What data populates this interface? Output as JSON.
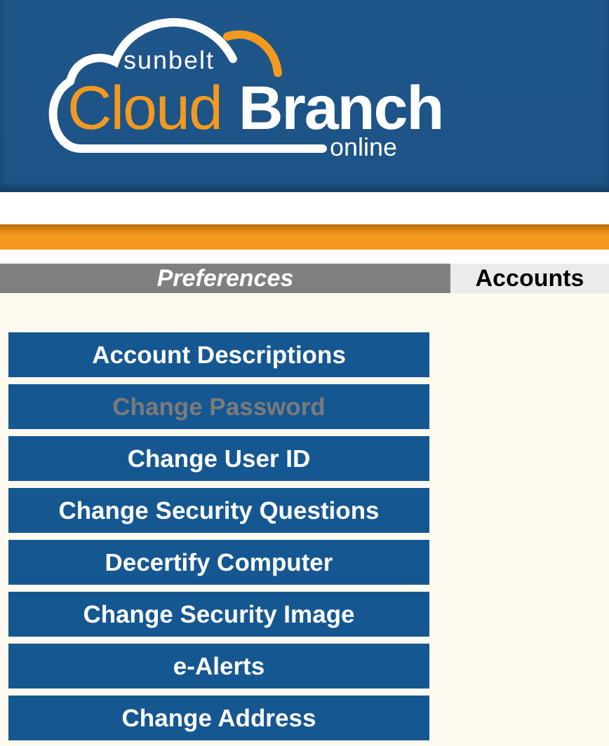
{
  "logo": {
    "tagline": "sunbelt",
    "word_1": "Cloud",
    "word_2": "Branch",
    "subtitle": "online"
  },
  "tabs": [
    {
      "label": "Preferences",
      "selected": true
    },
    {
      "label": "Accounts",
      "selected": false
    }
  ],
  "menu": [
    {
      "label": "Account Descriptions",
      "disabled": false
    },
    {
      "label": "Change Password",
      "disabled": true
    },
    {
      "label": "Change User ID",
      "disabled": false
    },
    {
      "label": "Change Security Questions",
      "disabled": false
    },
    {
      "label": "Decertify Computer",
      "disabled": false
    },
    {
      "label": "Change Security Image",
      "disabled": false
    },
    {
      "label": "e-Alerts",
      "disabled": false
    },
    {
      "label": "Change Address",
      "disabled": false
    }
  ]
}
